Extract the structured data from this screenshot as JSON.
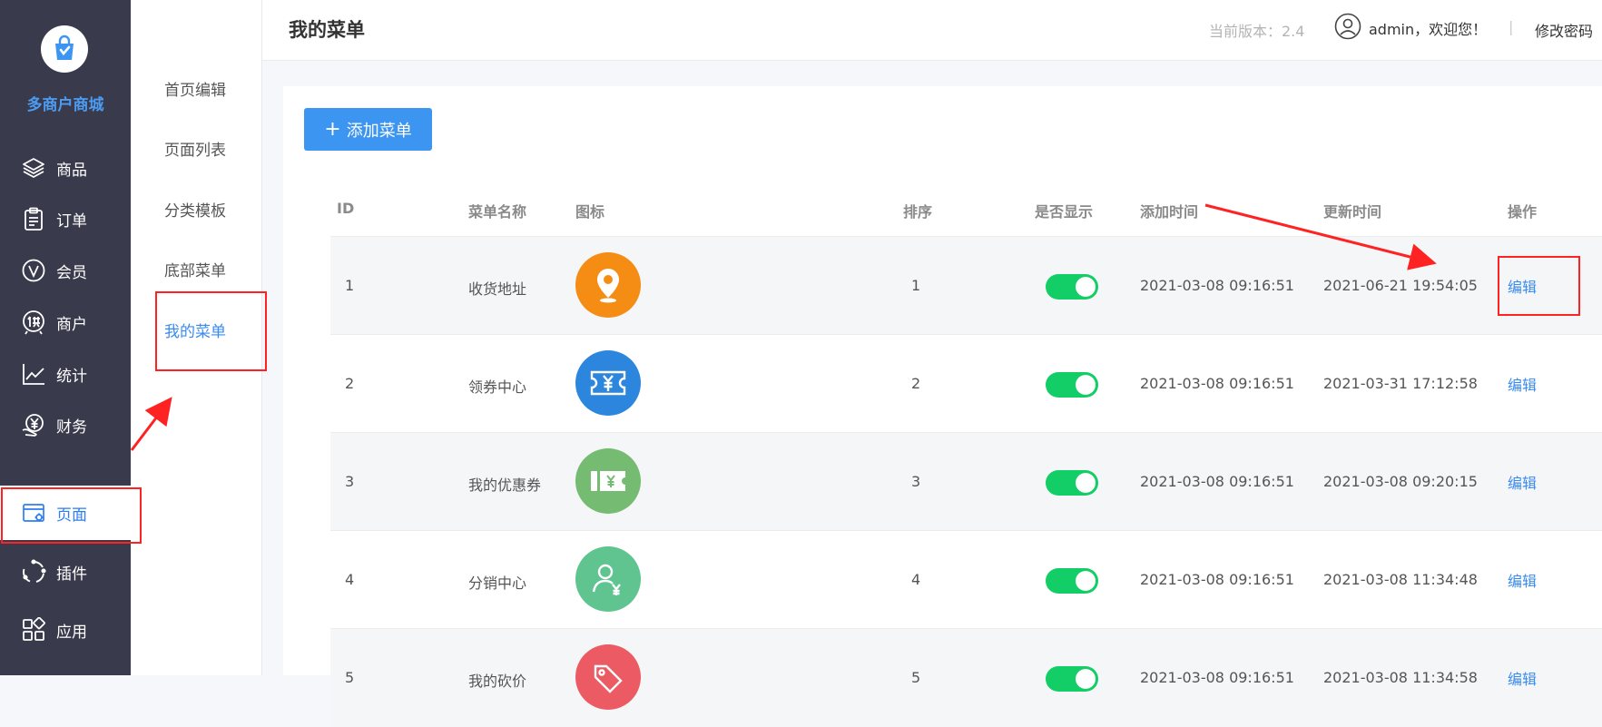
{
  "nav": {
    "brand": "多商户商城",
    "items": [
      {
        "label": "商品",
        "icon": "layers-icon"
      },
      {
        "label": "订单",
        "icon": "clipboard-icon"
      },
      {
        "label": "会员",
        "icon": "member-v-icon"
      },
      {
        "label": "商户",
        "icon": "supplier-icon"
      },
      {
        "label": "统计",
        "icon": "line-chart-icon"
      },
      {
        "label": "财务",
        "icon": "yen-hand-icon"
      },
      {
        "label": "页面",
        "icon": "page-settings-icon"
      },
      {
        "label": "插件",
        "icon": "plugin-icon"
      },
      {
        "label": "应用",
        "icon": "apps-icon"
      }
    ],
    "active": "页面"
  },
  "subnav": {
    "items": [
      "首页编辑",
      "页面列表",
      "分类模板",
      "底部菜单",
      "我的菜单"
    ],
    "active": "我的菜单"
  },
  "header": {
    "title": "我的菜单",
    "version": "当前版本：2.4",
    "user": "admin，欢迎您！",
    "separator": "|",
    "change_password": "修改密码"
  },
  "toolbar": {
    "add_plus": "+",
    "add_label": "添加菜单"
  },
  "table": {
    "columns": [
      "ID",
      "菜单名称",
      "图标",
      "排序",
      "是否显示",
      "添加时间",
      "更新时间",
      "操作"
    ],
    "rows": [
      {
        "id": "1",
        "name": "收货地址",
        "icon": "location-pin-icon",
        "color": "#f58d14",
        "sort": "1",
        "show": true,
        "created": "2021-03-08 09:16:51",
        "updated": "2021-06-21 19:54:05",
        "action": "编辑"
      },
      {
        "id": "2",
        "name": "领券中心",
        "icon": "yen-ticket-icon",
        "color": "#2c86dd",
        "sort": "2",
        "show": true,
        "created": "2021-03-08 09:16:51",
        "updated": "2021-03-31 17:12:58",
        "action": "编辑"
      },
      {
        "id": "3",
        "name": "我的优惠券",
        "icon": "coupon-icon",
        "color": "#76bb72",
        "sort": "3",
        "show": true,
        "created": "2021-03-08 09:16:51",
        "updated": "2021-03-08 09:20:15",
        "action": "编辑"
      },
      {
        "id": "4",
        "name": "分销中心",
        "icon": "user-yen-icon",
        "color": "#5fc48f",
        "sort": "4",
        "show": true,
        "created": "2021-03-08 09:16:51",
        "updated": "2021-03-08 11:34:48",
        "action": "编辑"
      },
      {
        "id": "5",
        "name": "我的砍价",
        "icon": "price-tag-icon",
        "color": "#ec5a63",
        "sort": "5",
        "show": true,
        "created": "2021-03-08 09:16:51",
        "updated": "2021-03-08 11:34:58",
        "action": "编辑"
      }
    ]
  },
  "colors": {
    "nav_bg": "#393a4c",
    "accent": "#3d95f2",
    "switch_on": "#13ce66",
    "annotation": "#ff2222"
  }
}
